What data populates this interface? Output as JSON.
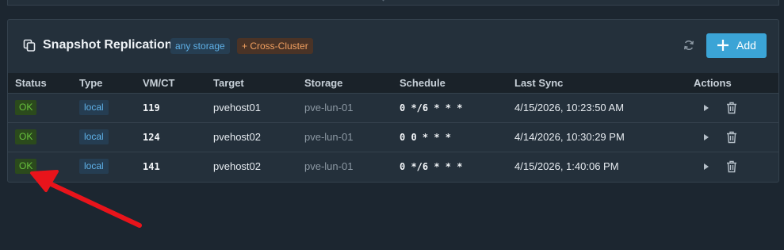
{
  "card": {
    "title": "Snapshot Replication",
    "badges": {
      "storage": "any storage",
      "cross_cluster": "+ Cross-Cluster"
    },
    "add_label": "Add"
  },
  "table": {
    "columns": [
      "Status",
      "Type",
      "VM/CT",
      "Target",
      "Storage",
      "Schedule",
      "Last Sync",
      "Actions"
    ],
    "rows": [
      {
        "status": "OK",
        "type": "local",
        "vmct": "119",
        "target": "pvehost01",
        "storage": "pve-lun-01",
        "schedule": "0 */6 * * *",
        "last_sync": "4/15/2026, 10:23:50 AM"
      },
      {
        "status": "OK",
        "type": "local",
        "vmct": "124",
        "target": "pvehost02",
        "storage": "pve-lun-01",
        "schedule": "0 0 * * *",
        "last_sync": "4/14/2026, 10:30:29 PM"
      },
      {
        "status": "OK",
        "type": "local",
        "vmct": "141",
        "target": "pvehost02",
        "storage": "pve-lun-01",
        "schedule": "0 */6 * * *",
        "last_sync": "4/15/2026, 1:40:06 PM"
      }
    ]
  },
  "colors": {
    "background": "#1c2630",
    "card": "#24303b",
    "accent": "#3ba4d6",
    "ok": "#67c13d",
    "cross_cluster": "#f2a060",
    "annotation_arrow": "#e8141b"
  },
  "icons": {
    "title": "copy-icon",
    "refresh": "refresh-icon",
    "add": "plus-icon",
    "run": "play-icon",
    "delete": "trash-icon"
  }
}
